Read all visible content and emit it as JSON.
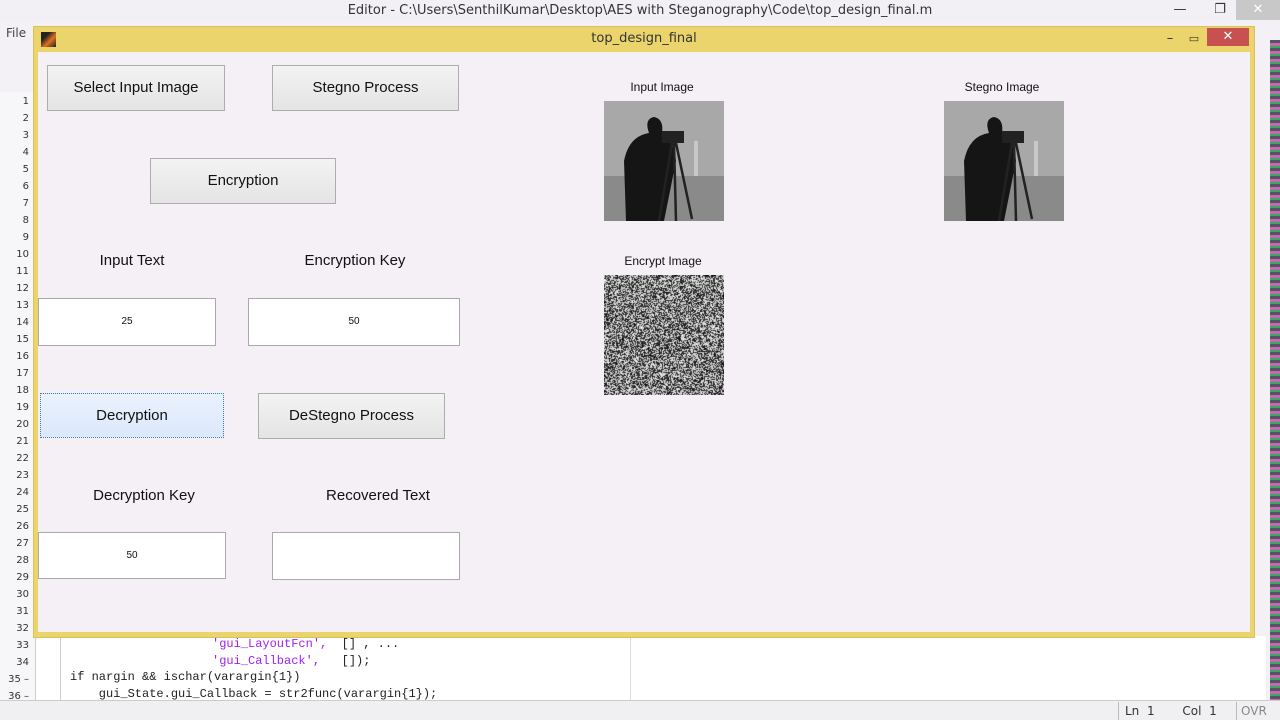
{
  "editor": {
    "title": "Editor - C:\\Users\\SenthilKumar\\Desktop\\AES with Steganography\\Code\\top_design_final.m",
    "menu_file": "File",
    "line_numbers": [
      "1",
      "2",
      "3",
      "4",
      "5",
      "6",
      "7",
      "8",
      "9",
      "10",
      "11",
      "12",
      "13",
      "14",
      "15",
      "16",
      "17",
      "18",
      "19",
      "20",
      "21",
      "22",
      "23",
      "24",
      "25",
      "26",
      "27",
      "28",
      "29",
      "30",
      "31",
      "32",
      "33",
      "34",
      "35 –",
      "36 –"
    ],
    "code": {
      "l33_str": "'gui_LayoutFcn',",
      "l33_rest": "  [] , ...",
      "l34_str": "'gui_Callback',",
      "l34_rest": "   []);",
      "l35": "if nargin && ischar(varargin{1})",
      "l36": "    gui_State.gui_Callback = str2func(varargin{1});"
    },
    "status": {
      "ln_label": "Ln",
      "ln": "1",
      "col_label": "Col",
      "col": "1",
      "ovr": "OVR"
    }
  },
  "figure": {
    "title": "top_design_final",
    "buttons": {
      "select": "Select Input Image",
      "stegno": "Stegno Process",
      "encryption": "Encryption",
      "decryption": "Decryption",
      "destegno": "DeStegno Process"
    },
    "labels": {
      "input_text": "Input Text",
      "encryption_key": "Encryption Key",
      "decryption_key": "Decryption Key",
      "recovered_text": "Recovered Text"
    },
    "fields": {
      "input_text": "25",
      "encryption_key": "50",
      "decryption_key": "50",
      "recovered_text": ""
    },
    "images": {
      "input": "Input Image",
      "stegno": "Stegno Image",
      "encrypt": "Encrypt Image"
    }
  },
  "colors": {
    "figure_border": "#ecd46c",
    "close": "#c75050"
  }
}
